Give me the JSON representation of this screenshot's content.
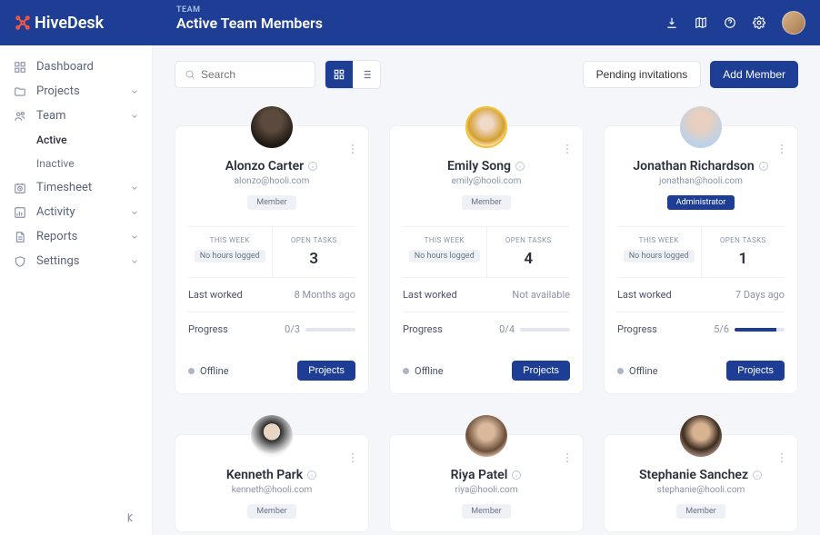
{
  "logo": "HiveDesk",
  "header": {
    "crumb": "TEAM",
    "title": "Active Team Members"
  },
  "toolbar": {
    "search_placeholder": "Search",
    "pending_label": "Pending invitations",
    "add_label": "Add Member"
  },
  "sidebar": {
    "dashboard": "Dashboard",
    "projects": "Projects",
    "team": "Team",
    "team_active": "Active",
    "team_inactive": "Inactive",
    "timesheet": "Timesheet",
    "activity": "Activity",
    "reports": "Reports",
    "settings": "Settings"
  },
  "labels": {
    "this_week": "THIS WEEK",
    "open_tasks": "OPEN TASKS",
    "no_hours": "No hours logged",
    "last_worked": "Last worked",
    "progress": "Progress",
    "offline": "Offline",
    "projects_btn": "Projects"
  },
  "roles": {
    "member": "Member",
    "admin": "Administrator"
  },
  "members": [
    {
      "name": "Alonzo Carter",
      "email": "alonzo@hooli.com",
      "role": "member",
      "tasks": "3",
      "last": "8 Months ago",
      "prog": "0/3",
      "pct": 0
    },
    {
      "name": "Emily Song",
      "email": "emily@hooli.com",
      "role": "member",
      "tasks": "4",
      "last": "Not available",
      "prog": "0/4",
      "pct": 0
    },
    {
      "name": "Jonathan Richardson",
      "email": "jonathan@hooli.com",
      "role": "admin",
      "tasks": "1",
      "last": "7 Days ago",
      "prog": "5/6",
      "pct": 83
    },
    {
      "name": "Kenneth Park",
      "email": "kenneth@hooli.com",
      "role": "member"
    },
    {
      "name": "Riya Patel",
      "email": "riya@hooli.com",
      "role": "member"
    },
    {
      "name": "Stephanie Sanchez",
      "email": "stephanie@hooli.com",
      "role": "member"
    }
  ]
}
